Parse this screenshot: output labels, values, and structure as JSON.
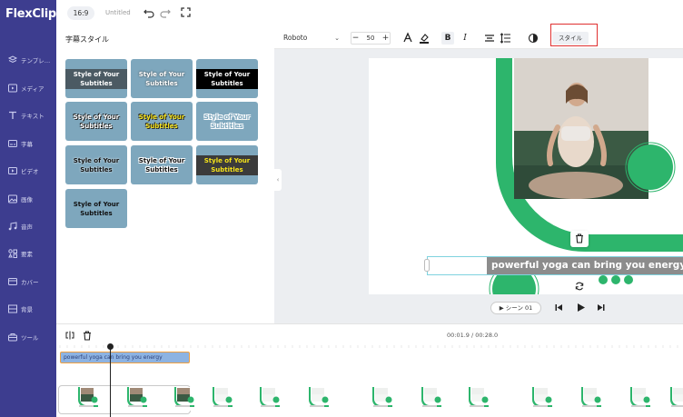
{
  "app": {
    "logo": "FlexClip"
  },
  "sidebar": {
    "items": [
      {
        "label": "テンプレ…",
        "icon": "layers-icon"
      },
      {
        "label": "メディア",
        "icon": "media-icon"
      },
      {
        "label": "テキスト",
        "icon": "text-icon"
      },
      {
        "label": "字幕",
        "icon": "subtitle-icon"
      },
      {
        "label": "ビデオ",
        "icon": "video-icon"
      },
      {
        "label": "画像",
        "icon": "image-icon"
      },
      {
        "label": "音声",
        "icon": "music-icon"
      },
      {
        "label": "要素",
        "icon": "elements-icon"
      },
      {
        "label": "カバー",
        "icon": "cover-icon"
      },
      {
        "label": "背景",
        "icon": "background-icon"
      },
      {
        "label": "ツール",
        "icon": "tools-icon"
      }
    ]
  },
  "topbar": {
    "ratio": "16:9",
    "title": "Untitled"
  },
  "panel": {
    "title": "字幕スタイル",
    "style_text": "Style of Your Subtitles"
  },
  "format_toolbar": {
    "font": "Roboto",
    "size": "50",
    "minus": "−",
    "plus": "+",
    "bold": "B",
    "italic": "I",
    "style_button": "スタイル"
  },
  "canvas": {
    "subtitle": "powerful yoga can bring you energy"
  },
  "playback": {
    "scene_label": "シーン 01"
  },
  "timeline": {
    "time": "00:01.9 / 00:28.0",
    "subtitle_clip": "powerful yoga can bring you energy"
  },
  "colors": {
    "sidebar": "#3d3d8f",
    "accent_green": "#2db56c",
    "tile": "#7ea7bd",
    "highlight": "#e03030"
  }
}
